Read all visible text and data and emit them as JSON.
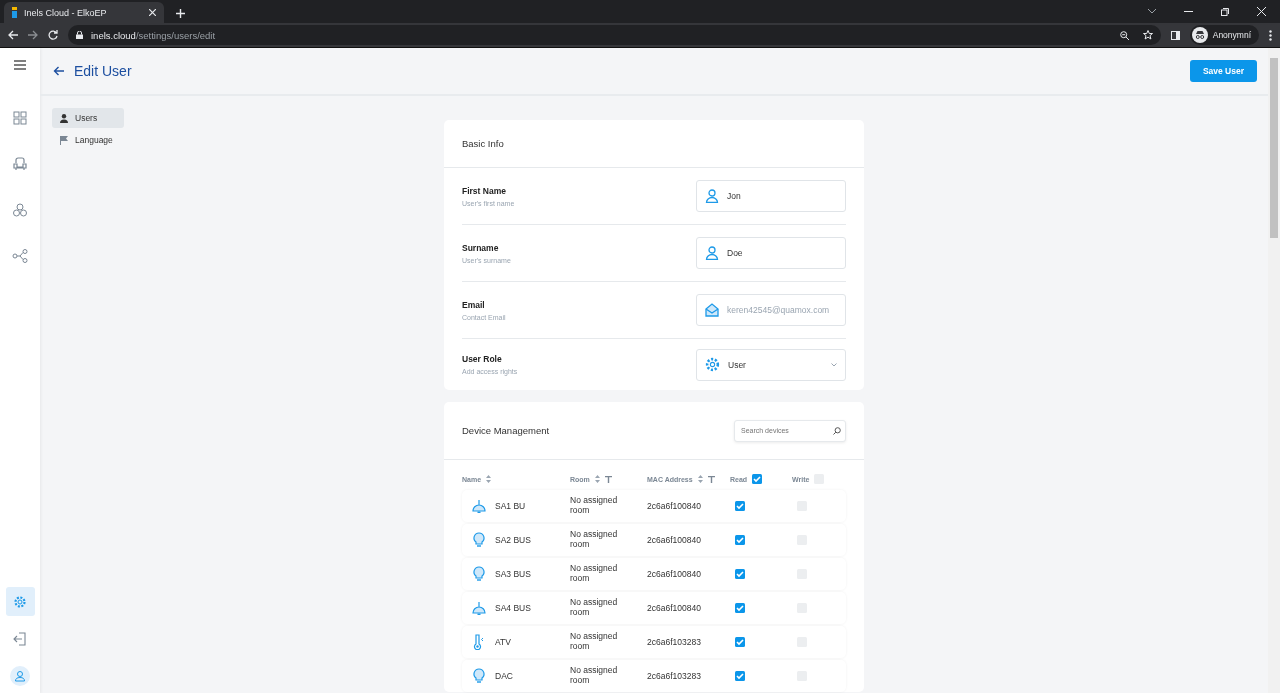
{
  "browser": {
    "tab_title": "Inels Cloud - ElkoEP",
    "url_host": "inels.cloud",
    "url_path": "/settings/users/edit",
    "profile": "Anonymní"
  },
  "rail": {
    "items": [
      {
        "kind": "dashboard",
        "selected": false
      },
      {
        "kind": "armchair",
        "selected": false
      },
      {
        "kind": "circles",
        "selected": false
      },
      {
        "kind": "share",
        "selected": false
      }
    ],
    "bottom": [
      {
        "kind": "settings",
        "selected": true
      },
      {
        "kind": "logout",
        "selected": false
      },
      {
        "kind": "avatar",
        "selected": false
      }
    ]
  },
  "header": {
    "title": "Edit User",
    "save_button": "Save User"
  },
  "settings_nav": [
    {
      "label": "Users",
      "kind": "user",
      "selected": true
    },
    {
      "label": "Language",
      "kind": "flag",
      "selected": false
    }
  ],
  "basic_info": {
    "title": "Basic Info",
    "fields": [
      {
        "label": "First Name",
        "hint": "User's first name",
        "kind": "person",
        "value": "Jon",
        "disabled": false
      },
      {
        "label": "Surname",
        "hint": "User's surname",
        "kind": "person",
        "value": "Doe",
        "disabled": false
      },
      {
        "label": "Email",
        "hint": "Contact Email",
        "kind": "mail",
        "value": "keren42545@quamox.com",
        "disabled": true
      },
      {
        "label": "User Role",
        "hint": "Add access rights",
        "kind": "select",
        "value": "User",
        "disabled": false
      }
    ]
  },
  "devices": {
    "title": "Device Management",
    "search": {
      "placeholder": "Search devices"
    },
    "columns": {
      "name": "Name",
      "room": "Room",
      "mac": "MAC Address",
      "read": "Read",
      "read_all": true,
      "write": "Write",
      "write_all": false
    },
    "rows": [
      {
        "kind": "lamp",
        "name": "SA1 BU",
        "room": "No assigned room",
        "mac": "2c6a6f100840",
        "read": true,
        "write": false
      },
      {
        "kind": "bulb",
        "name": "SA2 BUS",
        "room": "No assigned room",
        "mac": "2c6a6f100840",
        "read": true,
        "write": false
      },
      {
        "kind": "bulb",
        "name": "SA3 BUS",
        "room": "No assigned room",
        "mac": "2c6a6f100840",
        "read": true,
        "write": false
      },
      {
        "kind": "lamp",
        "name": "SA4 BUS",
        "room": "No assigned room",
        "mac": "2c6a6f100840",
        "read": true,
        "write": false
      },
      {
        "kind": "thermometer",
        "name": "ATV",
        "room": "No assigned room",
        "mac": "2c6a6f103283",
        "read": true,
        "write": false
      },
      {
        "kind": "bulb",
        "name": "DAC",
        "room": "No assigned room",
        "mac": "2c6a6f103283",
        "read": true,
        "write": false
      }
    ]
  }
}
